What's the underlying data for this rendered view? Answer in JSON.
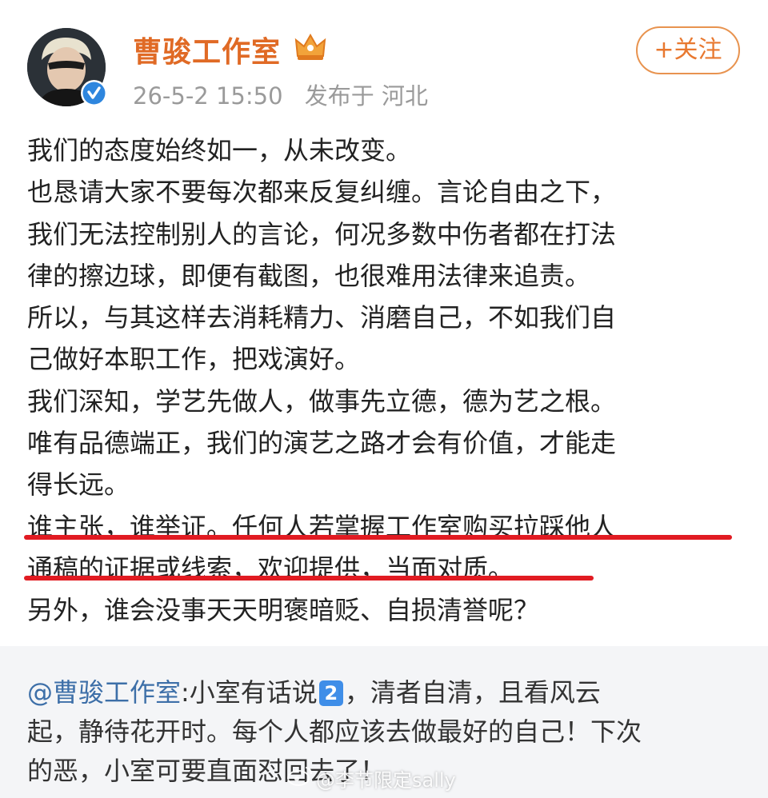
{
  "post": {
    "author": "曹骏工作室",
    "timestamp": "26-5-2 15:50",
    "location": "发布于 河北",
    "follow_label": "+关注",
    "body_lines": [
      "我们的态度始终如一，从未改变。",
      "也恳请大家不要每次都来反复纠缠。言论自由之下，",
      "我们无法控制别人的言论，何况多数中伤者都在打法",
      "律的擦边球，即便有截图，也很难用法律来追责。",
      "所以，与其这样去消耗精力、消磨自己，不如我们自",
      "己做好本职工作，把戏演好。",
      "我们深知，学艺先做人，做事先立德，德为艺之根。",
      "唯有品德端正，我们的演艺之路才会有价值，才能走",
      "得长远。",
      "谁主张，谁举证。任何人若掌握工作室购买拉踩他人",
      "通稿的证据或线索，欢迎提供，当面对质。",
      "另外，谁会没事天天明褒暗贬、自损清誉呢？"
    ],
    "highlight_color": "#e11b22"
  },
  "repost": {
    "mention": "@曹骏工作室",
    "line1_rest_a": ":小室有话说",
    "badge": "2",
    "line1_rest_b": "，清者自清，且看风云",
    "line2": "起，静待花开时。每个人都应该去做最好的自己！下次",
    "line3": "的恶，小室可要直面怼回去了！"
  },
  "watermark": "@李节限定sally",
  "colors": {
    "username": "#e06a25",
    "follow": "#e8782f",
    "mention": "#3d6fa8",
    "verified": "#2e86de",
    "repost_bg": "#f4f5f7"
  }
}
